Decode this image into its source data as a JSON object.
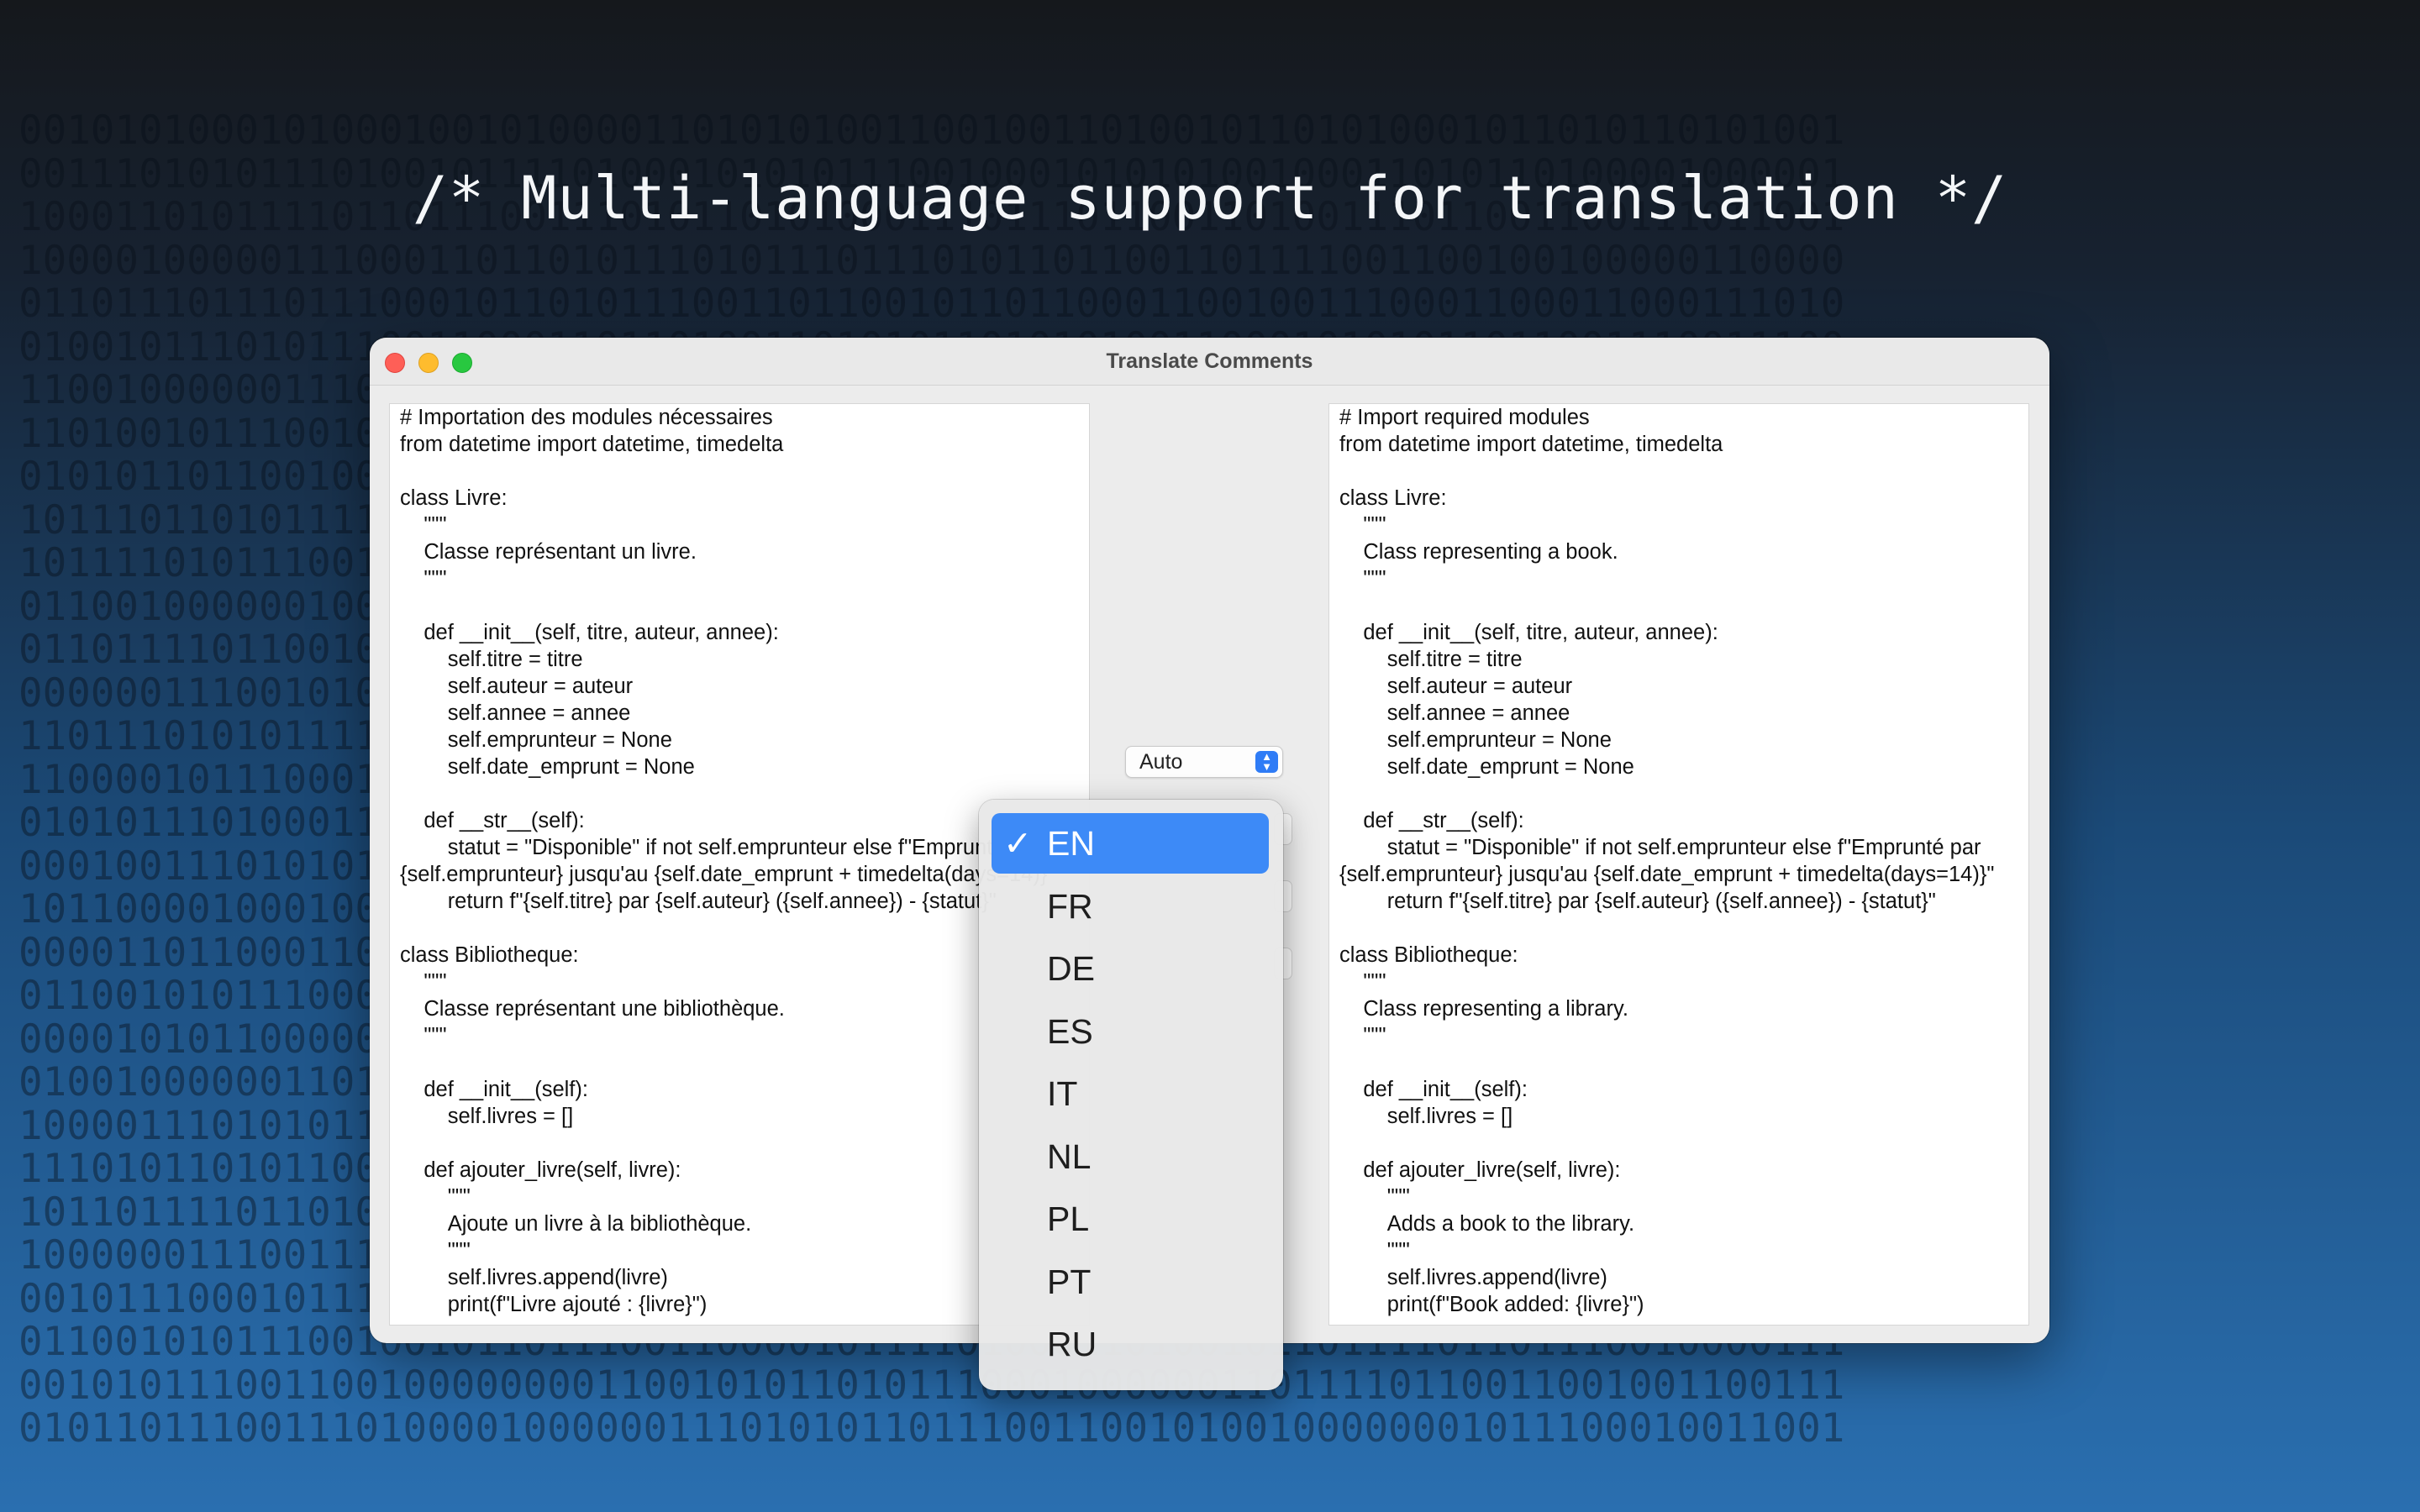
{
  "headline": "/* Multi-language support for translation */",
  "background_binary": [
    "0010101000101000100101000011010101001100100110100101101010001011010110101001",
    "0011101010111010010111101000101010111001000101010100100011010110100001000001",
    "1000110101111011011100111010110101000111011101100110100111011001100111011001",
    "1000010000011100011011010111010111011101011011001101111001100100100000110000",
    "0110111011101110001011010111001101100101101100011001001110001100011000111010",
    "0100101110101110011000110110100110101011010101001100010101011011001110011100",
    "1100100000011100001011101100011010001011011001000110110000000010000010000100",
    "1101001011100101100111010011001100110100101001101011010011111000110010000111",
    "0101011011001001011000110010110100111011011101010001010110010010001100010110",
    "1011101101011110010101101010011011110110101001000110001100101101001100110010",
    "1011110101110011001100010101110010011011010100100101011110101011011001010001",
    "0110010000001000001110110011010011011001011100110011000111001000000011000111",
    "0110111101100100011011010000100101100110011011110110010110011110111001000011",
    "0000001110010100101110011000111100101111001111010111111101101011101101100100",
    "1101110101011110111010101001110001111010101000010011001101110010010000000001",
    "1100001011100010101000101011000100100011101101011100110011100100011100000111",
    "0101011101000110001110111010011000100111110101011010101011000110001101111010",
    "0001001110101010101000100111100110110000000101101010111110110010000011110000",
    "1011000010001001001110111010001010011011101110110110110000101100111000001110",
    "0000110110001101011000101011010110011001001101110100010000111011010000111011",
    "0110010101110000111101010101001011011010011101000010100011010101000000110100",
    "0000101011000000011001001111000101110011000110101011011010111110110100000111",
    "0100100000011011111000101010110010001110111011111110100100111000101000001001",
    "1000011101010111011111101110000101111100000010000000110111111100111010011000",
    "1110101101011001001100000100100101100110111101100101100011011101001100001010",
    "1011011110110100011110011111011011101100100100110100101110101001000001001100",
    "1000000111001111000011010111000111101011001001001111011110000111001011010101",
    "0010111000101110101011010010111000010101110011001000000110100101101110011100",
    "0110010101110010010110111001100001011110100011010010110111101101110010000111",
    "0010101110011001000000001100101011010111000100000011011110110011001001100111",
    "0101101110011101000010000001110101011011100110010100100000001011100010011001"
  ],
  "window": {
    "title": "Translate Comments",
    "source_lines": [
      "# Importation des modules nécessaires",
      "from datetime import datetime, timedelta",
      "",
      "class Livre:",
      "    \"\"\"",
      "    Classe représentant un livre.",
      "    \"\"\"",
      "",
      "    def __init__(self, titre, auteur, annee):",
      "        self.titre = titre",
      "        self.auteur = auteur",
      "        self.annee = annee",
      "        self.emprunteur = None",
      "        self.date_emprunt = None",
      "",
      "    def __str__(self):",
      "        statut = \"Disponible\" if not self.emprunteur else f\"Emprunté par {self.emprunteur} jusqu'au {self.date_emprunt + timedelta(days=14)}\"",
      "        return f\"{self.titre} par {self.auteur} ({self.annee}) - {statut}\"",
      "",
      "class Bibliotheque:",
      "    \"\"\"",
      "    Classe représentant une bibliothèque.",
      "    \"\"\"",
      "",
      "    def __init__(self):",
      "        self.livres = []",
      "",
      "    def ajouter_livre(self, livre):",
      "        \"\"\"",
      "        Ajoute un livre à la bibliothèque.",
      "        \"\"\"",
      "        self.livres.append(livre)",
      "        print(f\"Livre ajouté : {livre}\")"
    ],
    "target_lines": [
      "# Import required modules",
      "from datetime import datetime, timedelta",
      "",
      "class Livre:",
      "    \"\"\"",
      "    Class representing a book.",
      "    \"\"\"",
      "",
      "    def __init__(self, titre, auteur, annee):",
      "        self.titre = titre",
      "        self.auteur = auteur",
      "        self.annee = annee",
      "        self.emprunteur = None",
      "        self.date_emprunt = None",
      "",
      "    def __str__(self):",
      "        statut = \"Disponible\" if not self.emprunteur else f\"Emprunté par {self.emprunteur} jusqu'au {self.date_emprunt + timedelta(days=14)}\"",
      "        return f\"{self.titre} par {self.auteur} ({self.annee}) - {statut}\"",
      "",
      "class Bibliotheque:",
      "    \"\"\"",
      "    Class representing a library.",
      "    \"\"\"",
      "",
      "    def __init__(self):",
      "        self.livres = []",
      "",
      "    def ajouter_livre(self, livre):",
      "        \"\"\"",
      "        Adds a book to the library.",
      "        \"\"\"",
      "        self.livres.append(livre)",
      "        print(f\"Book added: {livre}\")"
    ],
    "source_language": "Auto",
    "language_menu": {
      "check_mark": "✓",
      "selected": "EN",
      "options": [
        "EN",
        "FR",
        "DE",
        "ES",
        "IT",
        "NL",
        "PL",
        "PT",
        "RU"
      ]
    }
  },
  "colors": {
    "accent": "#3d8af7",
    "close": "#fe5f57",
    "minimize": "#febc2e",
    "maximize": "#28c840"
  }
}
